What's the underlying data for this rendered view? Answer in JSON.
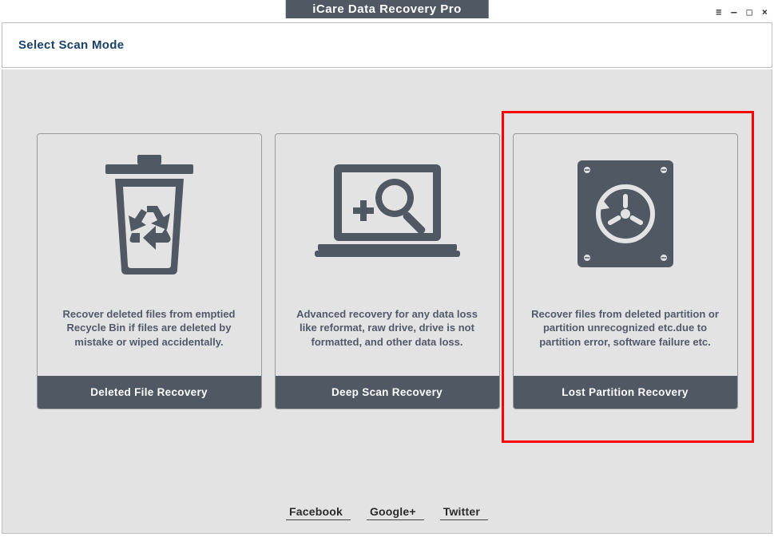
{
  "window": {
    "title": "iCare Data Recovery Pro"
  },
  "header": {
    "title": "Select Scan Mode"
  },
  "cards": [
    {
      "desc": "Recover deleted files from emptied Recycle Bin if files are deleted by mistake or wiped accidentally.",
      "label": "Deleted File Recovery"
    },
    {
      "desc": "Advanced recovery for any data loss like reformat, raw drive, drive is not formatted, and other data loss.",
      "label": "Deep Scan Recovery"
    },
    {
      "desc": "Recover files from deleted partition or partition unrecognized etc.due to partition error, software failure etc.",
      "label": "Lost Partition Recovery"
    }
  ],
  "social": {
    "facebook": "Facebook",
    "google": "Google+",
    "twitter": "Twitter"
  }
}
